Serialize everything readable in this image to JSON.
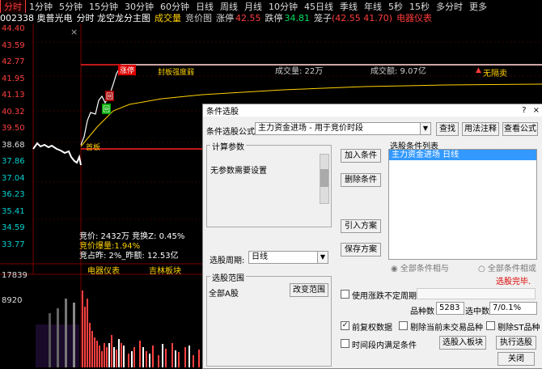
{
  "periods": [
    "分时",
    "1分钟",
    "5分钟",
    "15分钟",
    "30分钟",
    "60分钟",
    "日线",
    "周线",
    "月线",
    "10分钟",
    "45日线",
    "季线",
    "年线",
    "5秒",
    "15秒",
    "多分时",
    "更多"
  ],
  "active_period": 0,
  "info": {
    "code_name": "002338 奥普光电",
    "view": "分时 龙空龙分主图",
    "indicator1": "成交量",
    "indicator2": "竞价图",
    "limit_up_label": "涨停",
    "limit_up_value": "42.55",
    "limit_down_label": "跌停",
    "limit_down_value": "34.81",
    "cage_label": "笼子",
    "cage_value": "(42.55 41.70)",
    "meter": "电器仪表"
  },
  "price_axis": [
    "44.40",
    "43.59",
    "42.77",
    "41.95",
    "41.13",
    "40.32",
    "39.50",
    "38.68",
    "37.86",
    "37.04",
    "36.23",
    "35.41",
    "34.59",
    "33.77"
  ],
  "volume_axis": [
    "17839",
    "8920"
  ],
  "chart_marks": {
    "limit_up_tag": "涨停",
    "status_tag": "封板强度弱",
    "volume_text": "成交量: 22万",
    "amount_text": "成交额: 9.07亿",
    "no_sell": "无隔卖",
    "flag1": "回",
    "flag2": "回",
    "first_board": "首板",
    "open_board": "封板"
  },
  "auction": {
    "line1": "竞价: 2432万 竞换Z: 0.45%",
    "line2": "竞价爆量:1.94%",
    "line3": "竞占昨: 2%_昨额: 12.53亿",
    "tag1": "电器仪表",
    "tag2": "吉林板块"
  },
  "dialog": {
    "title": "条件选股",
    "formula_label": "条件选股公式",
    "formula_value": "主力资金进场  -  用于竞价时段",
    "btn_find": "查找",
    "btn_usage": "用法注释",
    "btn_view": "查看公式",
    "calc_params": "计算参数",
    "no_params": "无参数需要设置",
    "btn_add": "加入条件",
    "btn_delete": "删除条件",
    "btn_import": "引入方案",
    "btn_save": "保存方案",
    "cond_list_label": "选股条件列表",
    "cond_item": "主力资金进场   日线",
    "period_label": "选股周期:",
    "period_value": "日线",
    "radio_and": "全部条件相与",
    "radio_or": "全部条件相或",
    "done_text": "选股完毕.",
    "range_label": "选股范围",
    "range_value": "全部A股",
    "btn_change_range": "改变范围",
    "chk_uncertain": "使用涨跌不定周期",
    "species_label": "品种数",
    "species_value": "5283",
    "selected_label": "选中数",
    "selected_value": "7/0.1%",
    "chk_fq": "前复权数据",
    "chk_exclude_untraded": "剔除当前未交易品种",
    "chk_exclude_st": "剔除ST品种",
    "chk_period_satisfy": "时间段内满足条件",
    "btn_to_board": "选股入板块",
    "btn_run": "执行选股",
    "btn_close": "关闭",
    "help_icon": "?",
    "close_icon": "×"
  },
  "colors": {
    "accent_red": "#ff3b3b",
    "accent_yellow": "#ffd200",
    "selection_blue": "#3399ff",
    "up_red": "#ff4040",
    "down_cyan": "#00d0d0"
  }
}
